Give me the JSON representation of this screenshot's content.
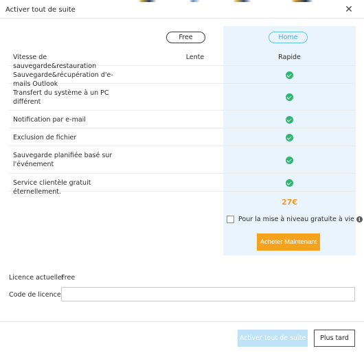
{
  "window": {
    "title": "Activer tout de suite"
  },
  "plans": {
    "free_label": "Free",
    "home_label": "Home"
  },
  "features": [
    {
      "label": "Vitesse de sauvegarde&restauration",
      "free": "Lente",
      "home": "Rapide"
    },
    {
      "label": "Sauvegarde&récupération d'e-mails Outlook",
      "free": "",
      "home": "check"
    },
    {
      "label": "Transfert du système à un PC différent",
      "free": "",
      "home": "check"
    },
    {
      "label": "Notification par e-mail",
      "free": "",
      "home": "check"
    },
    {
      "label": "Exclusion de fichier",
      "free": "",
      "home": "check"
    },
    {
      "label": "Sauvegarde planifiée basé sur l'événement",
      "free": "",
      "home": "check"
    },
    {
      "label": "Service clientèle gratuit éternellement.",
      "free": "",
      "home": "check"
    }
  ],
  "pricing": {
    "price": "27€",
    "upgrade_text": "Pour la mise à niveau gratuite à vie",
    "info_glyph": "i",
    "buy_label": "Acheter Maintenant"
  },
  "license": {
    "current_label": "Licence actuelle:",
    "current_value": "Free",
    "code_label": "Code de licence:",
    "code_value": ""
  },
  "footer": {
    "activate_label": "Activer tout de suite",
    "later_label": "Plus tard"
  },
  "colors": {
    "accent_orange": "#f5a31c",
    "check_green": "#2fb574",
    "home_panel_bg": "#eaf4fd",
    "home_pill_border": "#64c3e8",
    "activate_disabled": "#bfe2f7"
  },
  "icons": {
    "close": "close-icon",
    "check": "check-circle-icon",
    "info": "info-icon"
  }
}
